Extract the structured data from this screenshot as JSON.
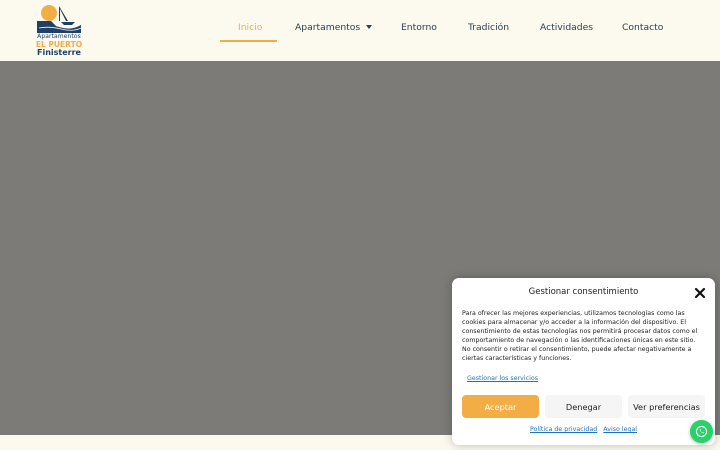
{
  "brand": {
    "line1": "Apartamentos",
    "line2": "EL PUERTO",
    "line3": "Finisterre"
  },
  "nav": {
    "items": [
      {
        "label": "Inicio",
        "active": true
      },
      {
        "label": "Apartamentos",
        "has_dropdown": true
      },
      {
        "label": "Entorno"
      },
      {
        "label": "Tradición"
      },
      {
        "label": "Actividades"
      },
      {
        "label": "Contacto"
      }
    ]
  },
  "consent": {
    "title": "Gestionar consentimiento",
    "body": "Para ofrecer las mejores experiencias, utilizamos tecnologías como las cookies para almacenar y/o acceder a la información del dispositivo. El consentimiento de estas tecnologías nos permitirá procesar datos como el comportamiento de navegación o las identificaciones únicas en este sitio. No consentir o retirar el consentimiento, puede afectar negativamente a ciertas características y funciones.",
    "services_link": "Gestionar los servicios",
    "accept_label": "Aceptar",
    "deny_label": "Denegar",
    "prefs_label": "Ver preferencias",
    "privacy_link": "Política de privacidad",
    "legal_link": "Aviso legal"
  },
  "colors": {
    "accent": "#f2ad45",
    "brand_navy": "#1e3f66",
    "hero_bg": "#7c7b78",
    "page_bg": "#fcf9ef",
    "whatsapp": "#25d366"
  },
  "icons": {
    "close": "close-icon",
    "dropdown": "chevron-down-icon",
    "whatsapp": "whatsapp-icon"
  }
}
